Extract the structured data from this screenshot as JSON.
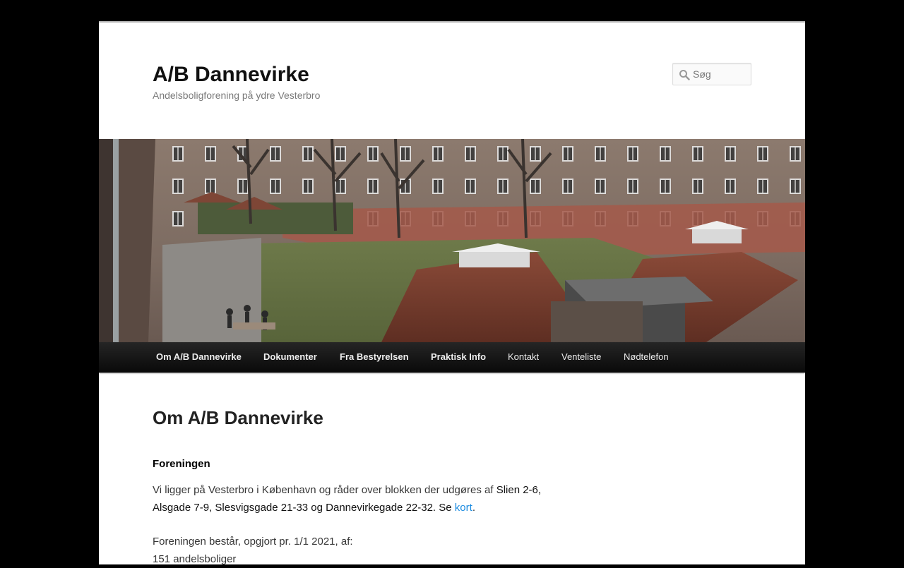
{
  "site": {
    "title": "A/B Dannevirke",
    "description": "Andelsboligforening på ydre Vesterbro"
  },
  "search": {
    "placeholder": "Søg",
    "icon": "search-icon"
  },
  "nav": {
    "items": [
      {
        "label": "Om A/B Dannevirke",
        "bold": true
      },
      {
        "label": "Dokumenter",
        "bold": true
      },
      {
        "label": "Fra Bestyrelsen",
        "bold": true
      },
      {
        "label": "Praktisk Info",
        "bold": true
      },
      {
        "label": "Kontakt",
        "bold": false
      },
      {
        "label": "Venteliste",
        "bold": false
      },
      {
        "label": "Nødtelefon",
        "bold": false
      }
    ]
  },
  "content": {
    "page_title": "Om A/B Dannevirke",
    "section_heading": "Foreningen",
    "intro_before": "Vi ligger på Vesterbro i København og råder over blokken der udgøres af ",
    "intro_streets": "Slien 2-6, Alsgade 7-9, Slesvigsgade 21-33 og Dannevirkegade 22-32. Se ",
    "intro_link": "kort",
    "intro_after": ".",
    "composition_intro": "Foreningen består, opgjort pr. 1/1 2021, af:",
    "composition_line1": "151 andelsboliger"
  },
  "colors": {
    "background": "#000000",
    "page": "#ffffff",
    "nav": "#1a1a1a",
    "link": "#1b8be0"
  }
}
